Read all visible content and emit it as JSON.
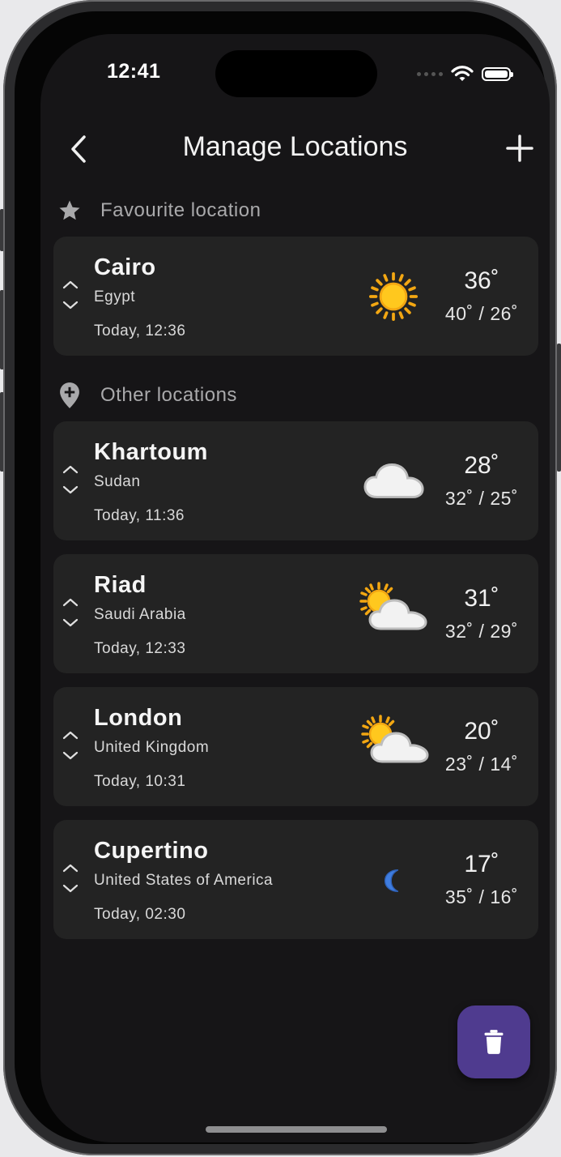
{
  "status_bar": {
    "time": "12:41"
  },
  "header": {
    "title": "Manage Locations"
  },
  "sections": {
    "favourite": {
      "label": "Favourite location"
    },
    "other": {
      "label": "Other locations"
    }
  },
  "locations": [
    {
      "city": "Cairo",
      "country": "Egypt",
      "time": "Today, 12:36",
      "temp": "36˚",
      "range": "40˚ / 26˚",
      "icon": "sun-icon"
    },
    {
      "city": "Khartoum",
      "country": "Sudan",
      "time": "Today, 11:36",
      "temp": "28˚",
      "range": "32˚ / 25˚",
      "icon": "cloud-icon"
    },
    {
      "city": "Riad",
      "country": "Saudi Arabia",
      "time": "Today, 12:33",
      "temp": "31˚",
      "range": "32˚ / 29˚",
      "icon": "partly-cloudy-icon"
    },
    {
      "city": "London",
      "country": "United Kingdom",
      "time": "Today, 10:31",
      "temp": "20˚",
      "range": "23˚ / 14˚",
      "icon": "partly-cloudy-icon"
    },
    {
      "city": "Cupertino",
      "country": "United States of America",
      "time": "Today, 02:30",
      "temp": "17˚",
      "range": "35˚ / 16˚",
      "icon": "moon-icon"
    }
  ],
  "colors": {
    "background": "#161517",
    "card": "#232323",
    "fab": "#4f3b8f",
    "section_label": "#a9a9ab"
  }
}
